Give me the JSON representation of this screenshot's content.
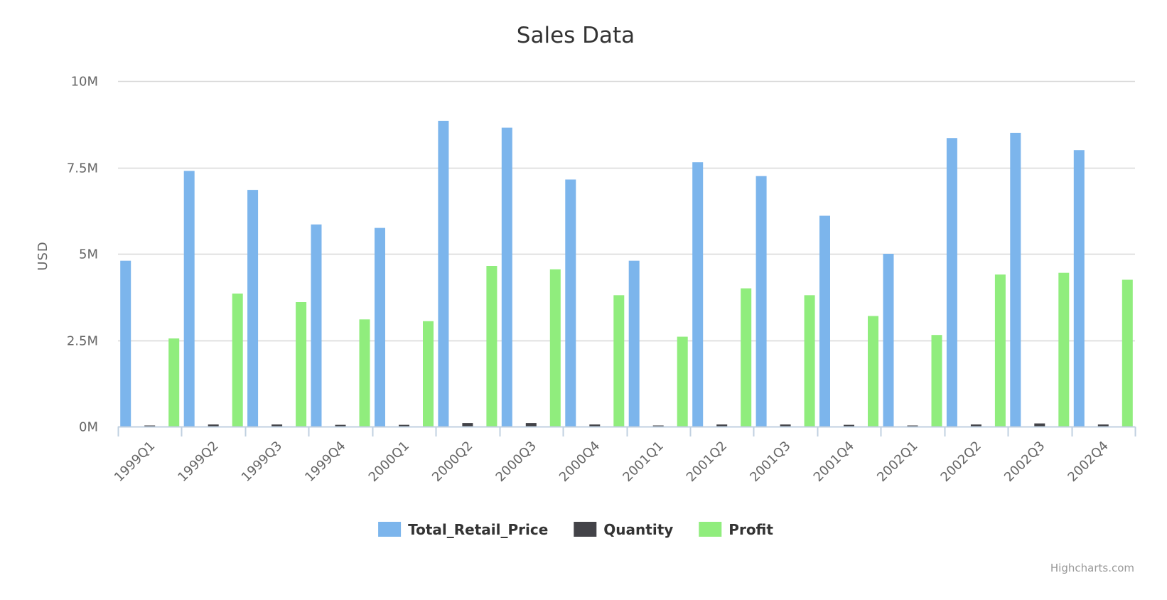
{
  "chart_data": {
    "type": "bar",
    "title": "Sales Data",
    "xlabel": "",
    "ylabel": "USD",
    "ylim": [
      0,
      10000000
    ],
    "grid": true,
    "legend_position": "bottom-center",
    "y_tick_values": [
      0,
      2500000,
      5000000,
      7500000,
      10000000
    ],
    "y_tick_labels": [
      "0M",
      "2.5M",
      "5M",
      "7.5M",
      "10M"
    ],
    "categories": [
      "1999Q1",
      "1999Q2",
      "1999Q3",
      "1999Q4",
      "2000Q1",
      "2000Q2",
      "2000Q3",
      "2000Q4",
      "2001Q1",
      "2001Q2",
      "2001Q3",
      "2001Q4",
      "2002Q1",
      "2002Q2",
      "2002Q3",
      "2002Q4"
    ],
    "series": [
      {
        "name": "Total_Retail_Price",
        "color": "#7cb5ec",
        "values": [
          4800000,
          7400000,
          6850000,
          5850000,
          5750000,
          8850000,
          8650000,
          7150000,
          4800000,
          7650000,
          7250000,
          6100000,
          5000000,
          8350000,
          8500000,
          8000000
        ]
      },
      {
        "name": "Quantity",
        "color": "#434348",
        "values": [
          30000,
          60000,
          60000,
          50000,
          50000,
          100000,
          100000,
          60000,
          30000,
          60000,
          60000,
          50000,
          30000,
          60000,
          90000,
          60000
        ]
      },
      {
        "name": "Profit",
        "color": "#90ed7d",
        "values": [
          2550000,
          3850000,
          3600000,
          3100000,
          3050000,
          4650000,
          4550000,
          3800000,
          2600000,
          4000000,
          3800000,
          3200000,
          2650000,
          4400000,
          4450000,
          4250000
        ]
      }
    ]
  },
  "credits": "Highcharts.com"
}
